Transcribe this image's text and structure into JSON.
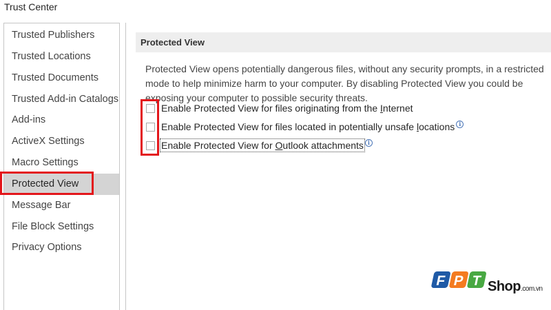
{
  "window": {
    "title": "Trust Center"
  },
  "sidebar": {
    "items": [
      {
        "label": "Trusted Publishers"
      },
      {
        "label": "Trusted Locations"
      },
      {
        "label": "Trusted Documents"
      },
      {
        "label": "Trusted Add-in Catalogs"
      },
      {
        "label": "Add-ins"
      },
      {
        "label": "ActiveX Settings"
      },
      {
        "label": "Macro Settings"
      },
      {
        "label": "Protected View",
        "selected": true
      },
      {
        "label": "Message Bar"
      },
      {
        "label": "File Block Settings"
      },
      {
        "label": "Privacy Options"
      }
    ]
  },
  "main": {
    "section_title": "Protected View",
    "description": "Protected View opens potentially dangerous files, without any security prompts, in a restricted mode to help minimize harm to your computer. By disabling Protected View you could be exposing your computer to possible security threats.",
    "options": [
      {
        "pre": "Enable Protected View for files originating from the ",
        "key": "I",
        "post": "nternet",
        "checked": false
      },
      {
        "pre": "Enable Protected View for files located in potentially unsafe ",
        "key": "l",
        "post": "ocations",
        "checked": false
      },
      {
        "pre": "Enable Protected View for ",
        "key": "O",
        "post": "utlook attachments",
        "checked": false
      }
    ],
    "info_glyph": "i"
  },
  "watermark": {
    "letters": [
      "F",
      "P",
      "T"
    ],
    "shop": "Shop",
    "domain": ".com.vn"
  },
  "colors": {
    "highlight": "#e3161b",
    "selected_bg": "#d4d4d4",
    "header_bg": "#eeeeee",
    "logo_blue": "#1f5aa6",
    "logo_orange": "#f47b20",
    "logo_green": "#48a842"
  }
}
